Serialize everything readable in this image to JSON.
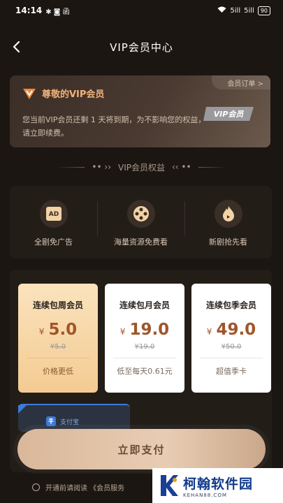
{
  "status_bar": {
    "time": "14:14",
    "left_icons": "✱ ◙ 函",
    "signal_1": "5ill",
    "signal_2": "5ill",
    "battery": "90"
  },
  "header": {
    "title": "VIP会员中心"
  },
  "vip_card": {
    "title": "尊敬的VIP会员",
    "orders_link": "会员订单 >",
    "description": "您当前VIP会员还剩 1 天将到期，为不影响您的权益，请立即续费。",
    "tag_text": "VIP会员"
  },
  "rights_header": {
    "label": "VIP会员权益",
    "left_decor": "•• ››",
    "right_decor": "‹‹ ••"
  },
  "benefits": [
    {
      "label": "全剧免广告",
      "icon": "ad-icon",
      "icon_text": "AD"
    },
    {
      "label": "海量资源免费看",
      "icon": "film-reel-icon"
    },
    {
      "label": "新剧抢先看",
      "icon": "flame-icon"
    }
  ],
  "packages": [
    {
      "name": "连续包周会员",
      "currency": "¥",
      "price": "5.0",
      "original": "¥5.0",
      "note": "价格更低",
      "selected": true
    },
    {
      "name": "连续包月会员",
      "currency": "¥",
      "price": "19.0",
      "original": "¥19.0",
      "note": "低至每天0.61元",
      "selected": false
    },
    {
      "name": "连续包季会员",
      "currency": "¥",
      "price": "49.0",
      "original": "¥50.0",
      "note": "超值季卡",
      "selected": false
    }
  ],
  "autopay": {
    "label": "支付宝"
  },
  "pay_button": {
    "label": "立即支付"
  },
  "agreement": {
    "text": "开通前请阅读 《会员服务"
  },
  "watermark": {
    "name": "柯翰软件园",
    "url": "KEHAN88.COM"
  },
  "colors": {
    "background": "#1b1612",
    "accent_gold": "#f2b27a",
    "price": "#a0562a",
    "selected_card": "#f3cb92",
    "pay_button": "#e8cdb3"
  }
}
